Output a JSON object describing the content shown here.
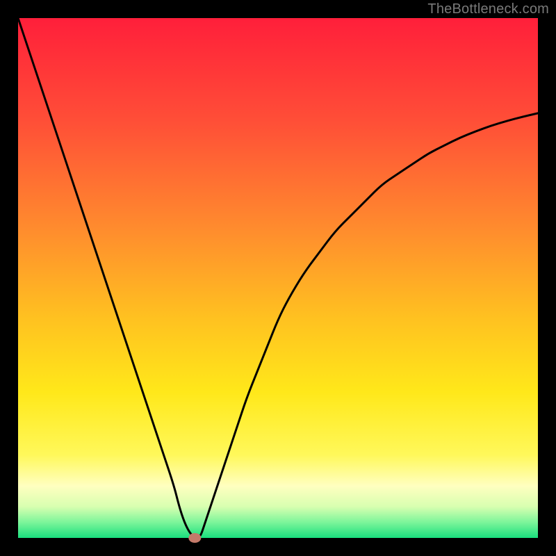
{
  "attribution": "TheBottleneck.com",
  "chart_data": {
    "type": "line",
    "title": "",
    "xlabel": "",
    "ylabel": "",
    "xlim": [
      0,
      100
    ],
    "ylim": [
      0,
      100
    ],
    "x": [
      0,
      2,
      4,
      6,
      8,
      10,
      12,
      14,
      16,
      18,
      20,
      22,
      24,
      26,
      28,
      30,
      31,
      32,
      33,
      34,
      35,
      36,
      38,
      40,
      42,
      44,
      46,
      48,
      50,
      52,
      55,
      58,
      61,
      64,
      67,
      70,
      73,
      76,
      79,
      82,
      85,
      88,
      91,
      94,
      97,
      100
    ],
    "values": [
      100,
      94,
      88,
      82,
      76,
      70,
      64,
      58,
      52,
      46,
      40,
      34,
      28,
      22,
      16,
      10,
      6,
      3,
      1,
      0,
      0,
      3,
      9,
      15,
      21,
      27,
      32,
      37,
      42,
      46,
      51,
      55,
      59,
      62,
      65,
      68,
      70,
      72,
      74,
      75.5,
      77,
      78.2,
      79.3,
      80.2,
      81,
      81.7
    ],
    "background_gradient": {
      "stops": [
        {
          "offset": 0.0,
          "color": "#ff1f3a"
        },
        {
          "offset": 0.2,
          "color": "#ff4f37"
        },
        {
          "offset": 0.4,
          "color": "#ff8a2e"
        },
        {
          "offset": 0.58,
          "color": "#ffc220"
        },
        {
          "offset": 0.72,
          "color": "#ffe81a"
        },
        {
          "offset": 0.84,
          "color": "#fff85a"
        },
        {
          "offset": 0.9,
          "color": "#ffffc0"
        },
        {
          "offset": 0.94,
          "color": "#d8ffb0"
        },
        {
          "offset": 0.97,
          "color": "#7cf59a"
        },
        {
          "offset": 1.0,
          "color": "#1adf7e"
        }
      ]
    },
    "marker": {
      "x": 34,
      "y": 0,
      "color": "#c47a6a",
      "rx": 9,
      "ry": 7
    }
  },
  "frame": {
    "outer_size": 800,
    "border_width": 26,
    "border_color": "#000000"
  },
  "curve_style": {
    "stroke": "#000000",
    "width": 3
  }
}
